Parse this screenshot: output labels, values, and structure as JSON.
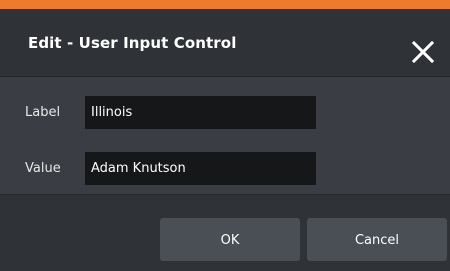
{
  "dialog": {
    "title": "Edit - User Input Control",
    "close_icon": "close-icon",
    "accent_color": "#ee7a2d"
  },
  "fields": [
    {
      "label": "Label",
      "value": "Illinois"
    },
    {
      "label": "Value",
      "value": "Adam Knutson"
    }
  ],
  "buttons": {
    "ok_label": "OK",
    "cancel_label": "Cancel"
  }
}
